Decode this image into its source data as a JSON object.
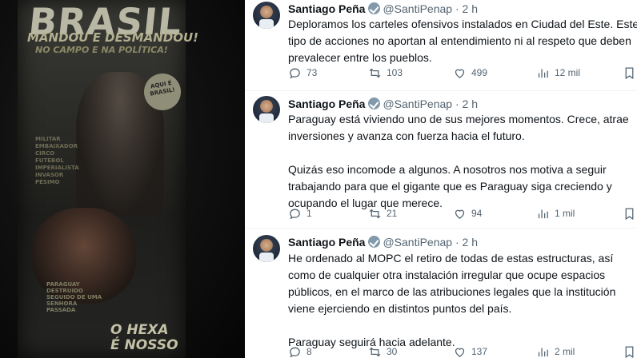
{
  "poster": {
    "title": "BRASIL",
    "subtitle": "MANDOU E DESMANDOU!",
    "tagline": "NO CAMPO E NA POLÍTICA!",
    "bubble": "AQUI É BRASIL!",
    "side_text": "MILITAR\nEMBAIXADOR\nCIRCO\nFUTEBOL\nIMPERIALISTA\nINVASOR\nPÉSIMO",
    "small_text": "PARAGUAY\nDESTRUIDO\nSEGUIDO DE UMA\nSENHORA\nPASSADA",
    "hexa": "O HEXA\nÉ NOSSO"
  },
  "tweets": [
    {
      "name": "Santiago Peña",
      "handle": "@SantiPenap",
      "time": "· 2 h",
      "paragraphs": [
        "Deploramos los carteles ofensivos instalados en Ciudad del Este. Este tipo de acciones no aportan al entendimiento ni al respeto que deben prevalecer entre los pueblos."
      ],
      "replies": "73",
      "reposts": "103",
      "likes": "499",
      "views": "12 mil"
    },
    {
      "name": "Santiago Peña",
      "handle": "@SantiPenap",
      "time": "· 2 h",
      "paragraphs": [
        "Paraguay está viviendo uno de sus mejores momentos. Crece, atrae inversiones y avanza con fuerza hacia el futuro.",
        "Quizás eso incomode a algunos. A nosotros nos motiva a seguir trabajando para que el gigante que es Paraguay siga creciendo y ocupando el lugar que merece."
      ],
      "replies": "1",
      "reposts": "21",
      "likes": "94",
      "views": "1 mil"
    },
    {
      "name": "Santiago Peña",
      "handle": "@SantiPenap",
      "time": "· 2 h",
      "paragraphs": [
        "He ordenado al MOPC el retiro de todas de estas estructuras, así como de cualquier otra instalación irregular que ocupe espacios públicos, en el marco de las atribuciones legales que la institución viene ejerciendo en distintos puntos del país.",
        "Paraguay seguirá hacia adelante."
      ],
      "replies": "8",
      "reposts": "30",
      "likes": "137",
      "views": "2 mil"
    }
  ],
  "colors": {
    "text": "#0f1419",
    "secondary": "#536471",
    "verified_badge": "#829aab"
  },
  "icons": [
    "reply-icon",
    "repost-icon",
    "like-icon",
    "views-icon",
    "bookmark-icon",
    "more-icon",
    "verified-icon"
  ]
}
